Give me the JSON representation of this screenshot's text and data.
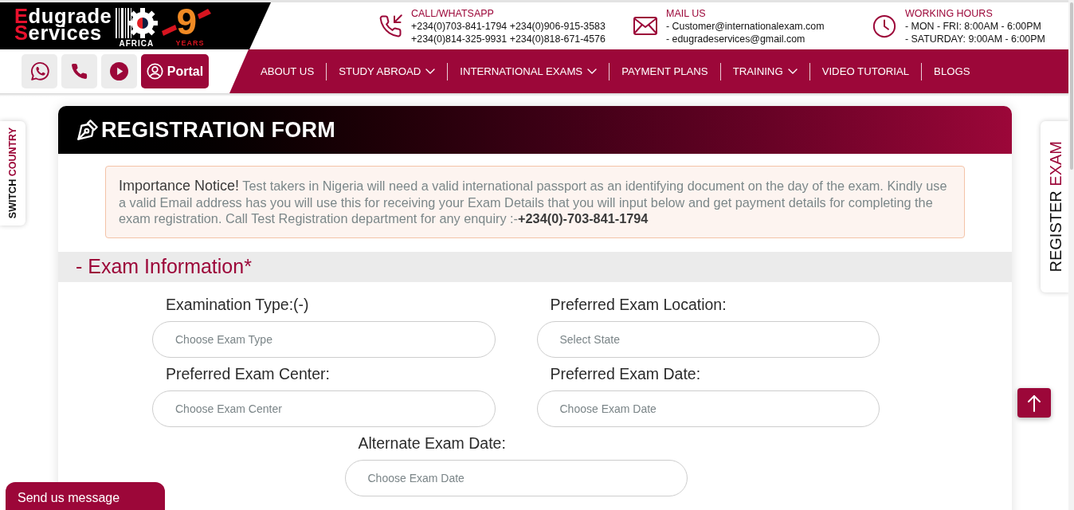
{
  "header": {
    "logo": {
      "lines": [
        "Edugrade",
        "Services"
      ],
      "region": "AFRICA",
      "badge_number": "9",
      "badge_label": "YEARS"
    },
    "contacts": [
      {
        "kind": "phone",
        "title": "CALL/WHATSAPP",
        "lines": [
          "+234(0)703-841-1794 +234(0)906-915-3583",
          "+234(0)814-325-9931 +234(0)818-671-4576"
        ]
      },
      {
        "kind": "mail",
        "title": "MAIL US",
        "lines": [
          "- Customer@internationalexam.com",
          "- edugradeservices@gmail.com"
        ]
      },
      {
        "kind": "clock",
        "title": "WORKING HOURS",
        "lines": [
          "- MON - FRI: 8:00AM - 6:00PM",
          "- SATURDAY: 9:00AM - 6:00PM"
        ]
      }
    ]
  },
  "quick_links": [
    {
      "kind": "whatsapp"
    },
    {
      "kind": "phone"
    },
    {
      "kind": "play"
    },
    {
      "kind": "portal",
      "label": "Portal"
    }
  ],
  "nav": [
    {
      "label": "ABOUT US",
      "dropdown": false
    },
    {
      "label": "STUDY ABROAD",
      "dropdown": true
    },
    {
      "label": "INTERNATIONAL EXAMS",
      "dropdown": true
    },
    {
      "label": "PAYMENT PLANS",
      "dropdown": false
    },
    {
      "label": "TRAINING",
      "dropdown": true
    },
    {
      "label": "VIDEO TUTORIAL",
      "dropdown": false
    },
    {
      "label": "BLOGS",
      "dropdown": false
    }
  ],
  "side_tabs": [
    {
      "kind": "left",
      "words": [
        {
          "text": "SWITCH",
          "accent": false
        },
        {
          "text": "COUNTRY",
          "accent": true
        }
      ]
    },
    {
      "kind": "right",
      "words": [
        {
          "text": "REGISTER",
          "accent": false
        },
        {
          "text": "EXAM",
          "accent": true
        }
      ]
    }
  ],
  "form": {
    "title": "REGISTRATION FORM",
    "notice": "**Importance Notice!** Test takers in Nigeria will need a valid international passport as an identifying document on the day of the exam. Kindly use a valid Email address has you will use this for receiving your Exam Details that you will input below and get payment details for completing the exam registration. Call Test Registration department for any enquiry :-**+234(0)-703-841-1794**",
    "section": "- Exam Information*",
    "fields": [
      {
        "label": "Examination Type:(-)",
        "placeholder": "Choose Exam Type"
      },
      {
        "label": "Preferred Exam Location:",
        "placeholder": "Select State"
      },
      {
        "label": "Preferred Exam Center:",
        "placeholder": "Choose Exam Center"
      },
      {
        "label": "Preferred Exam Date:",
        "placeholder": "Choose Exam Date"
      },
      {
        "label": "Alternate Exam Date:",
        "placeholder": "Choose Exam Date"
      }
    ]
  },
  "chat_tab": {
    "label": "Send us message"
  }
}
